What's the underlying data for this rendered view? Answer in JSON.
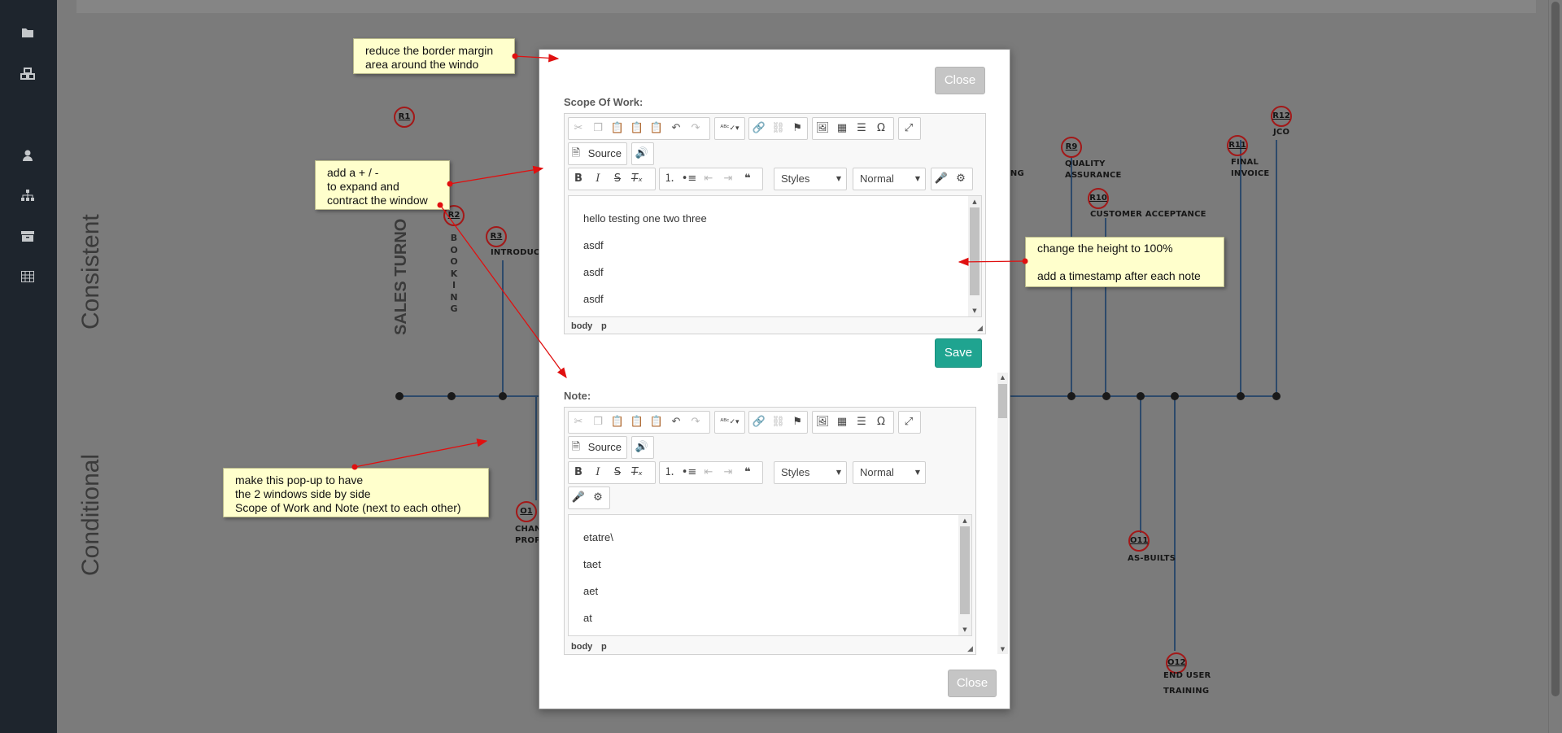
{
  "sidebar": {
    "icons": [
      "folder-icon",
      "cubes-icon",
      "user-icon",
      "sitemap-icon",
      "archive-icon",
      "table-icon"
    ]
  },
  "background": {
    "consistent_label": "Consistent",
    "conditional_label": "Conditional",
    "sales_label": "SALES TURNO",
    "booking_label": "BOOKING",
    "badges": {
      "r1": "R1",
      "r2": "R2",
      "r3": "R3",
      "r9": "R9",
      "r10": "R10",
      "r11": "R11",
      "r12": "R12",
      "o1": "O1",
      "o11": "O11",
      "o12": "O12"
    },
    "labels": {
      "introduct": "INTRODUCT",
      "ing": "ING",
      "quality_assurance_1": "QUALITY",
      "quality_assurance_2": "ASSURANCE",
      "customer_acceptance": "CUSTOMER ACCEPTANCE",
      "final_invoice_1": "FINAL",
      "final_invoice_2": "INVOICE",
      "jco": "JCO",
      "chan": "CHAN",
      "prop": "PROP",
      "as_builts": "AS-BUILTS",
      "end_user_1": "END USER",
      "end_user_2": "TRAINING"
    }
  },
  "annotations": {
    "border_margin": [
      "reduce the border margin",
      "area around the windo"
    ],
    "expand": [
      "add a + / -",
      "to expand and",
      "contract the window"
    ],
    "side_by_side": [
      "make this pop-up to have",
      "the 2 windows side by side",
      "Scope of Work and Note (next to each other)"
    ],
    "height": [
      "change the height to 100%",
      "add a timestamp after each note"
    ]
  },
  "modal": {
    "close_top": "Close",
    "close_bottom": "Close",
    "save": "Save",
    "scope": {
      "label": "Scope Of Work:",
      "source": "Source",
      "styles": "Styles",
      "format": "Normal",
      "lines": [
        "hello testing one two three",
        "asdf",
        "asdf",
        "asdf"
      ],
      "path": [
        "body",
        "p"
      ]
    },
    "note": {
      "label": "Note:",
      "source": "Source",
      "styles": "Styles",
      "format": "Normal",
      "lines": [
        "etatre\\",
        "taet",
        "aet",
        "at"
      ],
      "path": [
        "body",
        "p"
      ]
    }
  },
  "colors": {
    "save": "#1fa490",
    "close": "#c5c5c5",
    "arrow": "#e01010",
    "note_bg": "#ffffcc",
    "sidebar": "#1e252d",
    "timeline": "#2d4a6b"
  }
}
